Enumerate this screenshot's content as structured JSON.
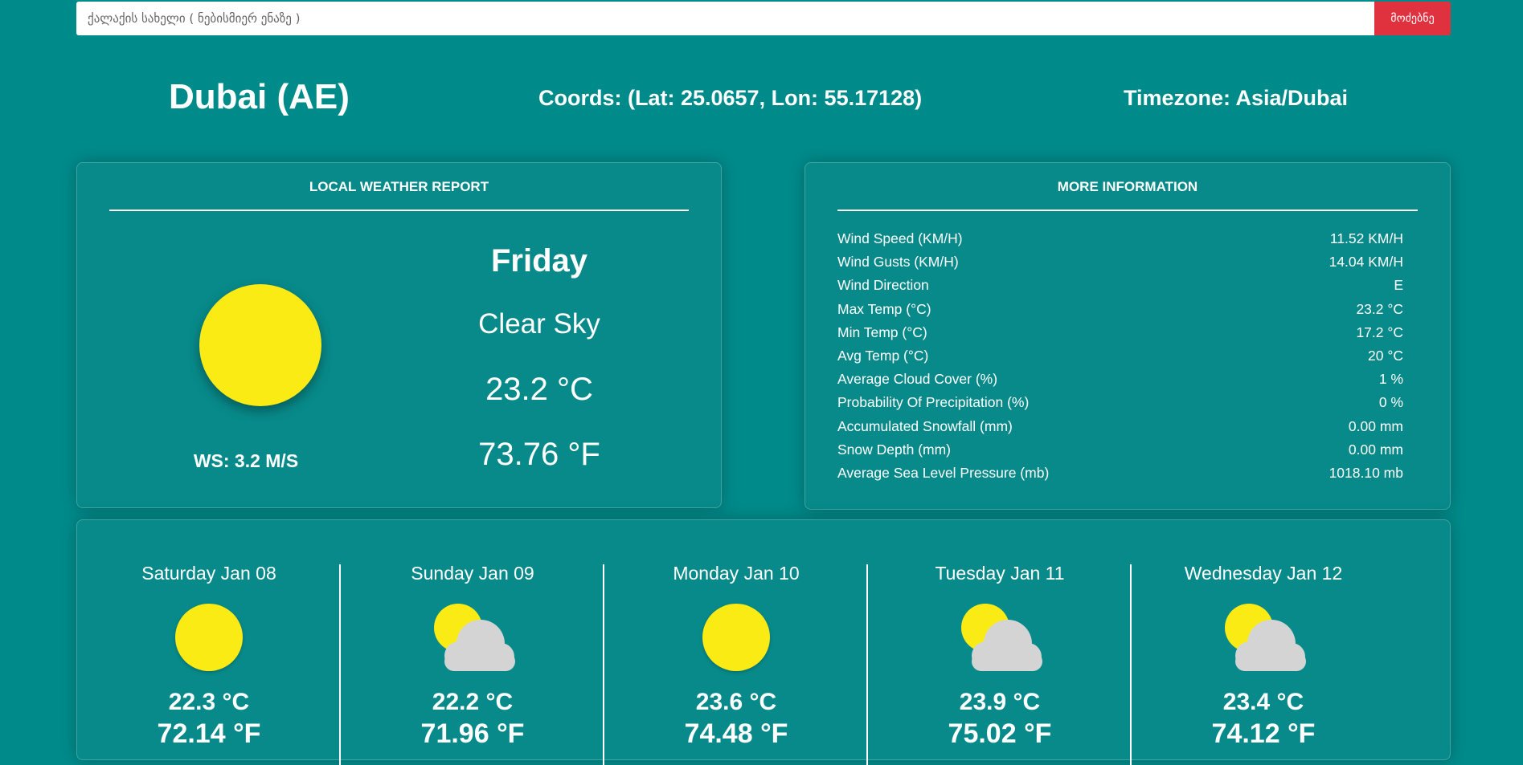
{
  "search": {
    "placeholder": "ქალაქის სახელი ( ნებისმიერ ენაზე )",
    "button_label": "მოძებნე"
  },
  "header": {
    "city": "Dubai (AE)",
    "coords": "Coords: (Lat: 25.0657, Lon: 55.17128)",
    "timezone": "Timezone: Asia/Dubai"
  },
  "local_report": {
    "title": "LOCAL WEATHER REPORT",
    "icon": "sun-icon",
    "wind_speed": "WS: 3.2 M/S",
    "day": "Friday",
    "condition": "Clear Sky",
    "temp_c": "23.2 °C",
    "temp_f": "73.76 °F"
  },
  "more_info": {
    "title": "MORE INFORMATION",
    "rows": [
      {
        "label": "Wind Speed (KM/H)",
        "value": "11.52 KM/H"
      },
      {
        "label": "Wind Gusts (KM/H)",
        "value": "14.04 KM/H"
      },
      {
        "label": "Wind Direction",
        "value": "E"
      },
      {
        "label": "Max Temp (°C)",
        "value": "23.2 °C"
      },
      {
        "label": "Min Temp (°C)",
        "value": "17.2 °C"
      },
      {
        "label": "Avg Temp (°C)",
        "value": "20 °C"
      },
      {
        "label": "Average Cloud Cover (%)",
        "value": "1 %"
      },
      {
        "label": "Probability Of Precipitation (%)",
        "value": "0 %"
      },
      {
        "label": "Accumulated Snowfall (mm)",
        "value": "0.00 mm"
      },
      {
        "label": "Snow Depth (mm)",
        "value": "0.00 mm"
      },
      {
        "label": "Average Sea Level Pressure (mb)",
        "value": "1018.10 mb"
      }
    ]
  },
  "forecast": [
    {
      "day": "Saturday Jan 08",
      "icon": "sun-icon",
      "temp_c": "22.3 °C",
      "temp_f": "72.14 °F"
    },
    {
      "day": "Sunday Jan 09",
      "icon": "partly-cloudy-icon",
      "temp_c": "22.2 °C",
      "temp_f": "71.96 °F"
    },
    {
      "day": "Monday Jan 10",
      "icon": "sun-icon",
      "temp_c": "23.6 °C",
      "temp_f": "74.48 °F"
    },
    {
      "day": "Tuesday Jan 11",
      "icon": "partly-cloudy-icon",
      "temp_c": "23.9 °C",
      "temp_f": "75.02 °F"
    },
    {
      "day": "Wednesday Jan 12",
      "icon": "partly-cloudy-icon",
      "temp_c": "23.4 °C",
      "temp_f": "74.12 °F"
    }
  ],
  "colors": {
    "background": "#008b8b",
    "accent_button": "#e0313f",
    "sun": "#fbeb14",
    "cloud": "#d4d4d4"
  }
}
